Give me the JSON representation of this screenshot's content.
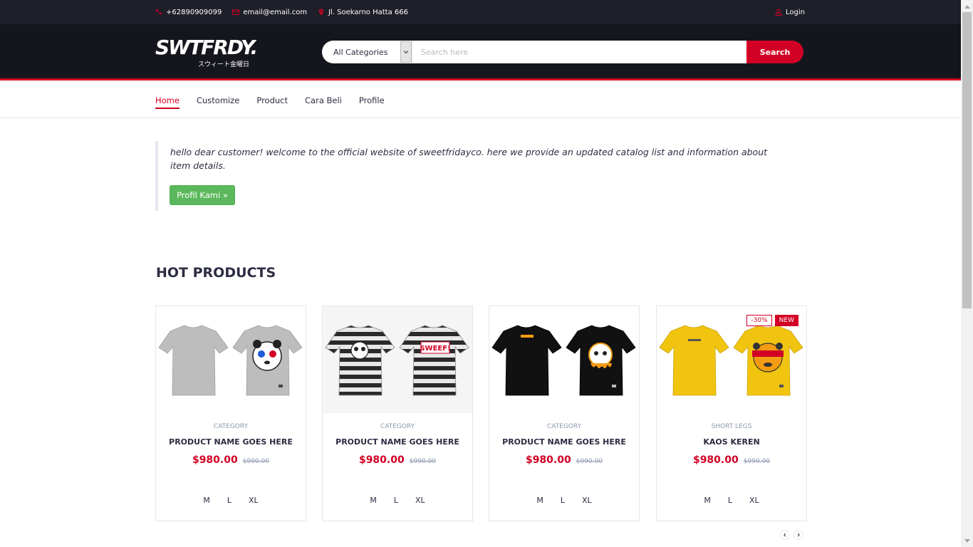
{
  "top_bar": {
    "phone": "+62890909099",
    "email": "email@email.com",
    "address": "Jl. Soekarno Hatta 666",
    "login": "Login"
  },
  "header": {
    "logo_text": "SWTFRDY.",
    "logo_sub": "スウィート金曜日",
    "category_select": "All Categories",
    "search_placeholder": "Search here",
    "search_button": "Search"
  },
  "nav": {
    "items": [
      "Home",
      "Customize",
      "Product",
      "Cara Beli",
      "Profile"
    ],
    "active": "Home"
  },
  "welcome": {
    "text": "hello dear customer! welcome to the official website of sweetfridayco. here we provide an updated catalog list and information about item details.",
    "button": "Profil Kami »"
  },
  "hot_products": {
    "title": "HOT PRODUCTS",
    "products": [
      {
        "category": "CATEGORY",
        "name": "PRODUCT NAME GOES HERE",
        "price": "$980.00",
        "old_price": "$990.00",
        "sizes": [
          "M",
          "L",
          "XL"
        ],
        "color": "#bdbdbd"
      },
      {
        "category": "CATEGORY",
        "name": "PRODUCT NAME GOES HERE",
        "price": "$980.00",
        "old_price": "$990.00",
        "sizes": [
          "M",
          "L",
          "XL"
        ],
        "color": "striped"
      },
      {
        "category": "CATEGORY",
        "name": "PRODUCT NAME GOES HERE",
        "price": "$980.00",
        "old_price": "$990.00",
        "sizes": [
          "M",
          "L",
          "XL"
        ],
        "color": "#111111"
      },
      {
        "category": "SHORT LEGS",
        "name": "KAOS KEREN",
        "price": "$980.00",
        "old_price": "$990.00",
        "sizes": [
          "M",
          "L",
          "XL"
        ],
        "color": "#f1c40f",
        "sale_label": "-30%",
        "new_label": "NEW"
      }
    ]
  },
  "colors": {
    "accent": "#d10024",
    "dark": "#15161d",
    "success": "#5cb85c"
  }
}
